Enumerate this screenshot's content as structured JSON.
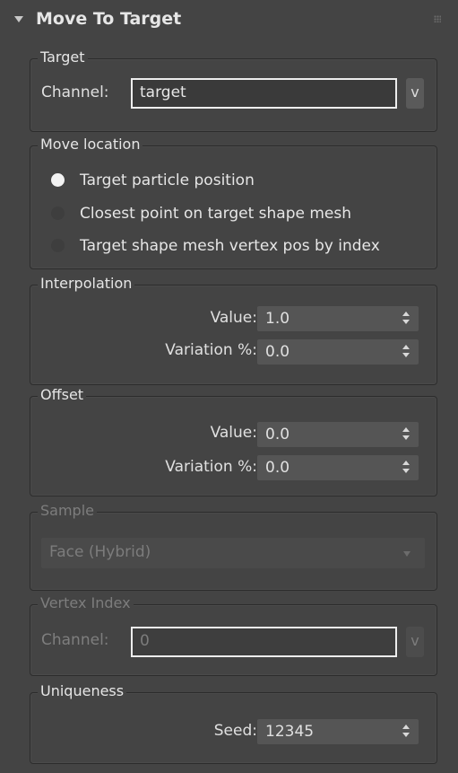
{
  "rollout": {
    "title": "Move To Target"
  },
  "target_group": {
    "title": "Target",
    "channel_label": "Channel:",
    "channel_value": "target",
    "v_button": "v"
  },
  "move_location": {
    "title": "Move location",
    "options": [
      {
        "label": "Target particle position",
        "selected": true
      },
      {
        "label": "Closest point on target shape mesh",
        "selected": false
      },
      {
        "label": "Target shape mesh vertex pos by index",
        "selected": false
      }
    ]
  },
  "interpolation": {
    "title": "Interpolation",
    "value_label": "Value:",
    "value": "1.0",
    "variation_label": "Variation %:",
    "variation": "0.0"
  },
  "offset": {
    "title": "Offset",
    "value_label": "Value:",
    "value": "0.0",
    "variation_label": "Variation %:",
    "variation": "0.0"
  },
  "sample": {
    "title": "Sample",
    "selected": "Face (Hybrid)",
    "enabled": false
  },
  "vertex_index": {
    "title": "Vertex Index",
    "channel_label": "Channel:",
    "channel_value": "0",
    "v_button": "v",
    "enabled": false
  },
  "uniqueness": {
    "title": "Uniqueness",
    "seed_label": "Seed:",
    "seed": "12345"
  },
  "colors": {
    "background": "#444444",
    "text": "#e0e0e0",
    "disabled_text": "#7c7c7c",
    "field_border_active": "#ededed"
  }
}
